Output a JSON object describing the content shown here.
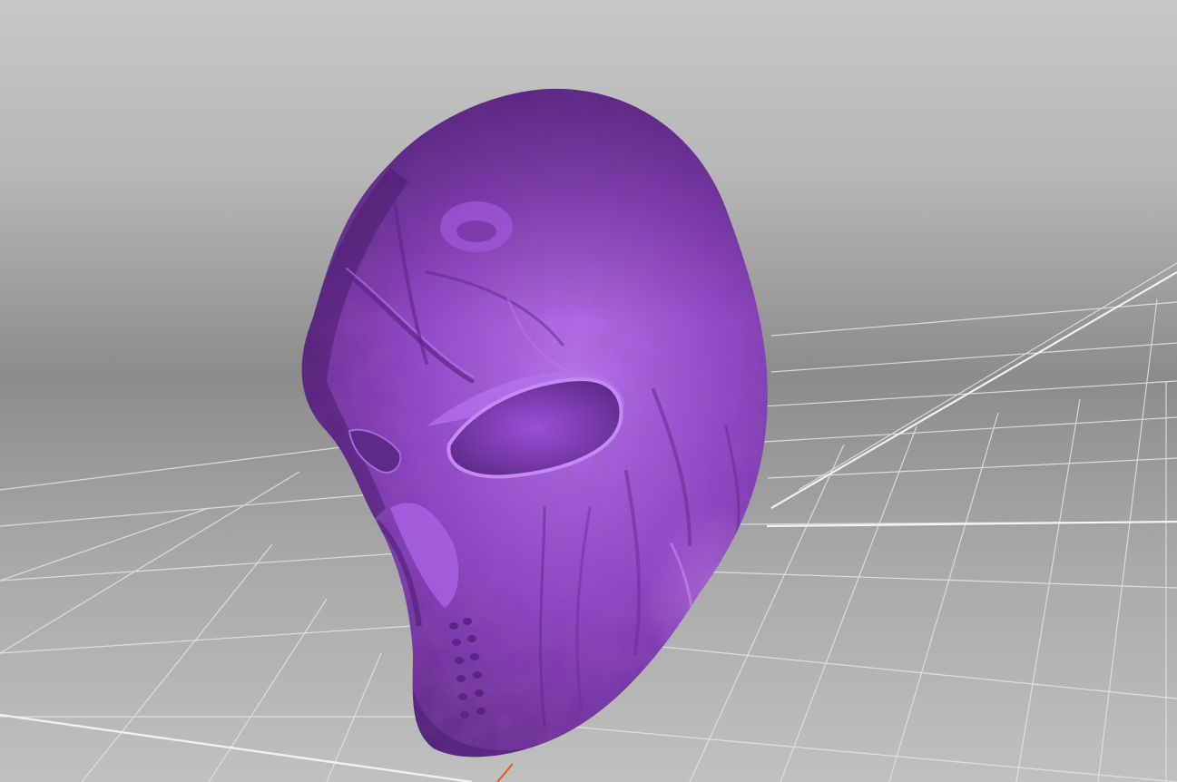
{
  "viewport": {
    "background_top_color": "#c7c7c7",
    "background_mid_color": "#8c8c8c",
    "background_bottom_color": "#c0c0c0",
    "grid_color": "#e4e4e4",
    "axis_color": "#f0f0f0",
    "origin_axis_color": "#e8551c",
    "grid_visible": true
  },
  "model": {
    "object": "sculpted mask",
    "base_color": "#8f45c8",
    "highlight_color": "#b775ef",
    "shadow_color": "#54227a"
  }
}
